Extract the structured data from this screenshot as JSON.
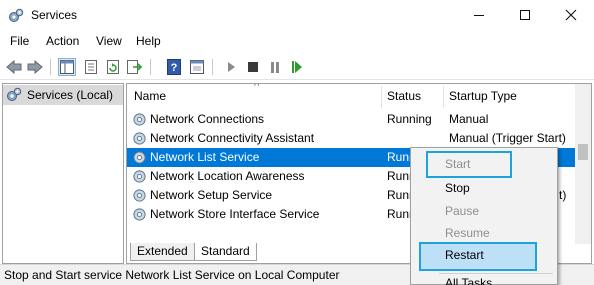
{
  "window": {
    "title": "Services"
  },
  "menu": [
    "File",
    "Action",
    "View",
    "Help"
  ],
  "toolbar": [
    "back-icon",
    "forward-icon",
    "show-console-tree-icon",
    "properties-icon",
    "refresh-icon",
    "export-icon",
    "help-icon",
    "console-icon",
    "start-icon",
    "stop-icon",
    "pause-icon",
    "restart-icon"
  ],
  "tree": {
    "root": "Services (Local)"
  },
  "columns": {
    "name": "Name",
    "status": "Status",
    "startup": "Startup Type"
  },
  "rows": [
    {
      "name": "Network Connections",
      "status": "Running",
      "startup": "Manual"
    },
    {
      "name": "Network Connectivity Assistant",
      "status": "",
      "startup": "Manual (Trigger Start)"
    },
    {
      "name": "Network List Service",
      "status": "Running",
      "startup": ""
    },
    {
      "name": "Network Location Awareness",
      "status": "Running",
      "startup": ""
    },
    {
      "name": "Network Setup Service",
      "status": "Running",
      "startup": "t)"
    },
    {
      "name": "Network Store Interface Service",
      "status": "Running",
      "startup": ""
    }
  ],
  "tabs": [
    "Extended",
    "Standard"
  ],
  "status": "Stop and Start service Network List Service on Local Computer",
  "context_menu": {
    "start": "Start",
    "stop": "Stop",
    "pause": "Pause",
    "resume": "Resume",
    "restart": "Restart",
    "all_tasks": "All Tasks"
  },
  "colors": {
    "selection": "#0078d7",
    "highlight_box": "#1ca3dc"
  }
}
